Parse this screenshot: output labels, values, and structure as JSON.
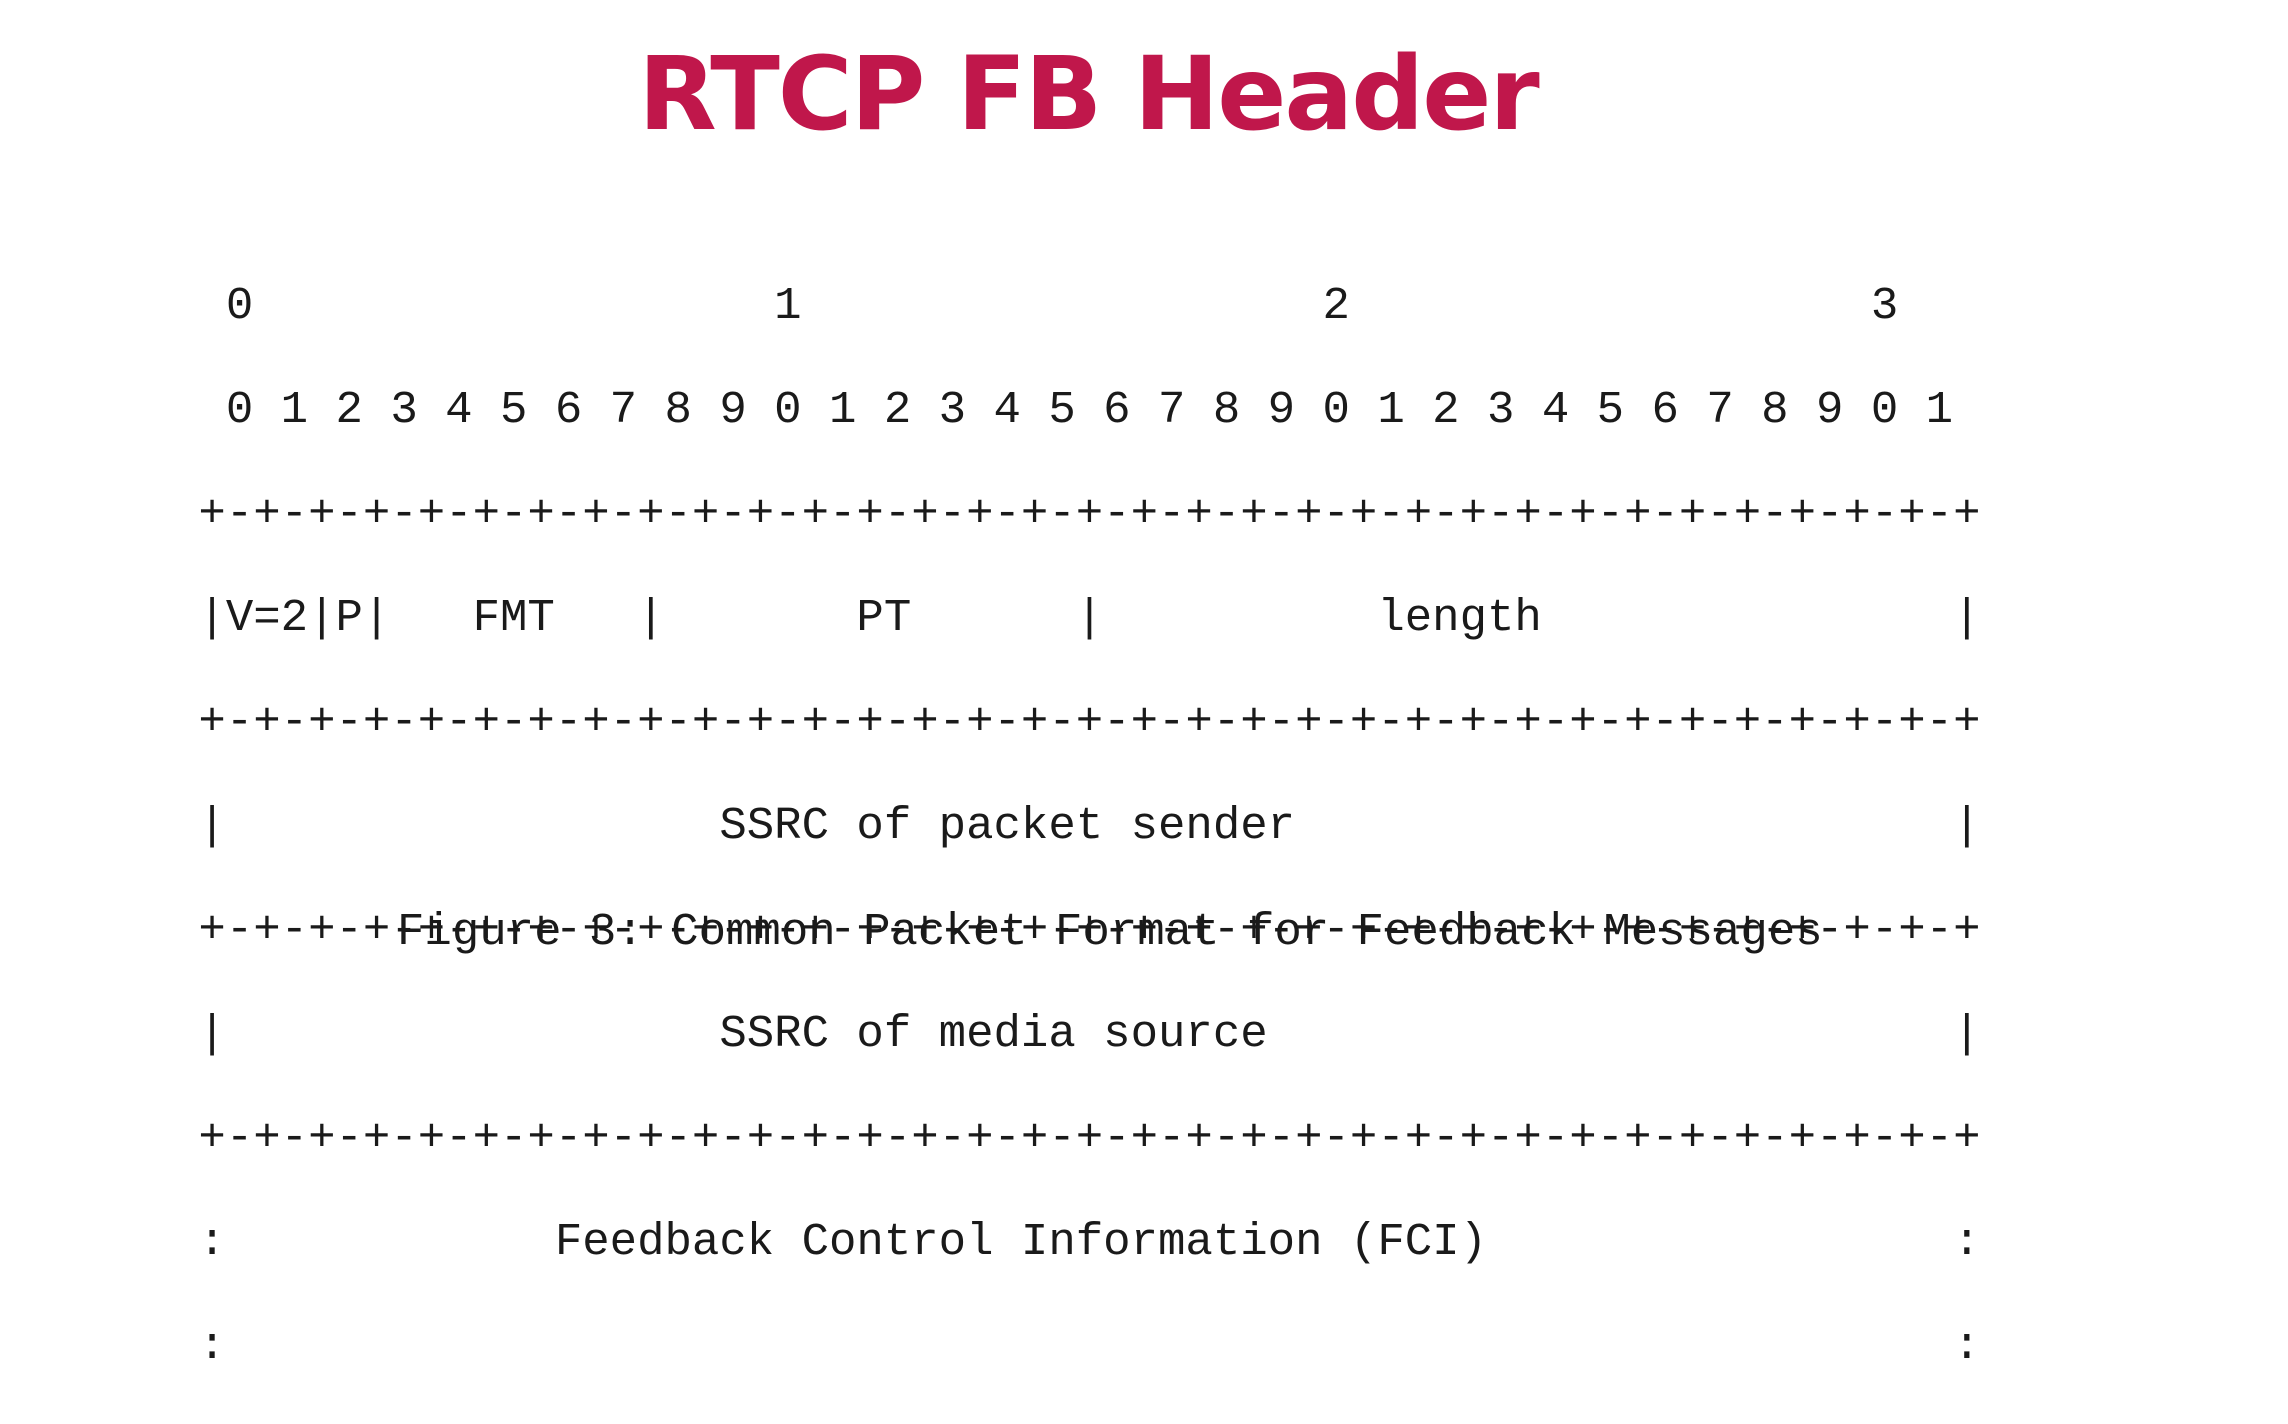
{
  "title": "RTCP FB Header",
  "diagram_lines": [
    "  0                   1                   2                   3",
    "  0 1 2 3 4 5 6 7 8 9 0 1 2 3 4 5 6 7 8 9 0 1 2 3 4 5 6 7 8 9 0 1",
    " +-+-+-+-+-+-+-+-+-+-+-+-+-+-+-+-+-+-+-+-+-+-+-+-+-+-+-+-+-+-+-+-+",
    " |V=2|P|   FMT   |       PT      |          length               |",
    " +-+-+-+-+-+-+-+-+-+-+-+-+-+-+-+-+-+-+-+-+-+-+-+-+-+-+-+-+-+-+-+-+",
    " |                  SSRC of packet sender                        |",
    " +-+-+-+-+-+-+-+-+-+-+-+-+-+-+-+-+-+-+-+-+-+-+-+-+-+-+-+-+-+-+-+-+",
    " |                  SSRC of media source                         |",
    " +-+-+-+-+-+-+-+-+-+-+-+-+-+-+-+-+-+-+-+-+-+-+-+-+-+-+-+-+-+-+-+-+",
    " :            Feedback Control Information (FCI)                 :",
    " :                                                               :"
  ],
  "caption": "Figure 3: Common Packet Format for Feedback Messages",
  "colors": {
    "title": "#c0174b",
    "text": "#1a1a1a",
    "background": "#ffffff"
  }
}
